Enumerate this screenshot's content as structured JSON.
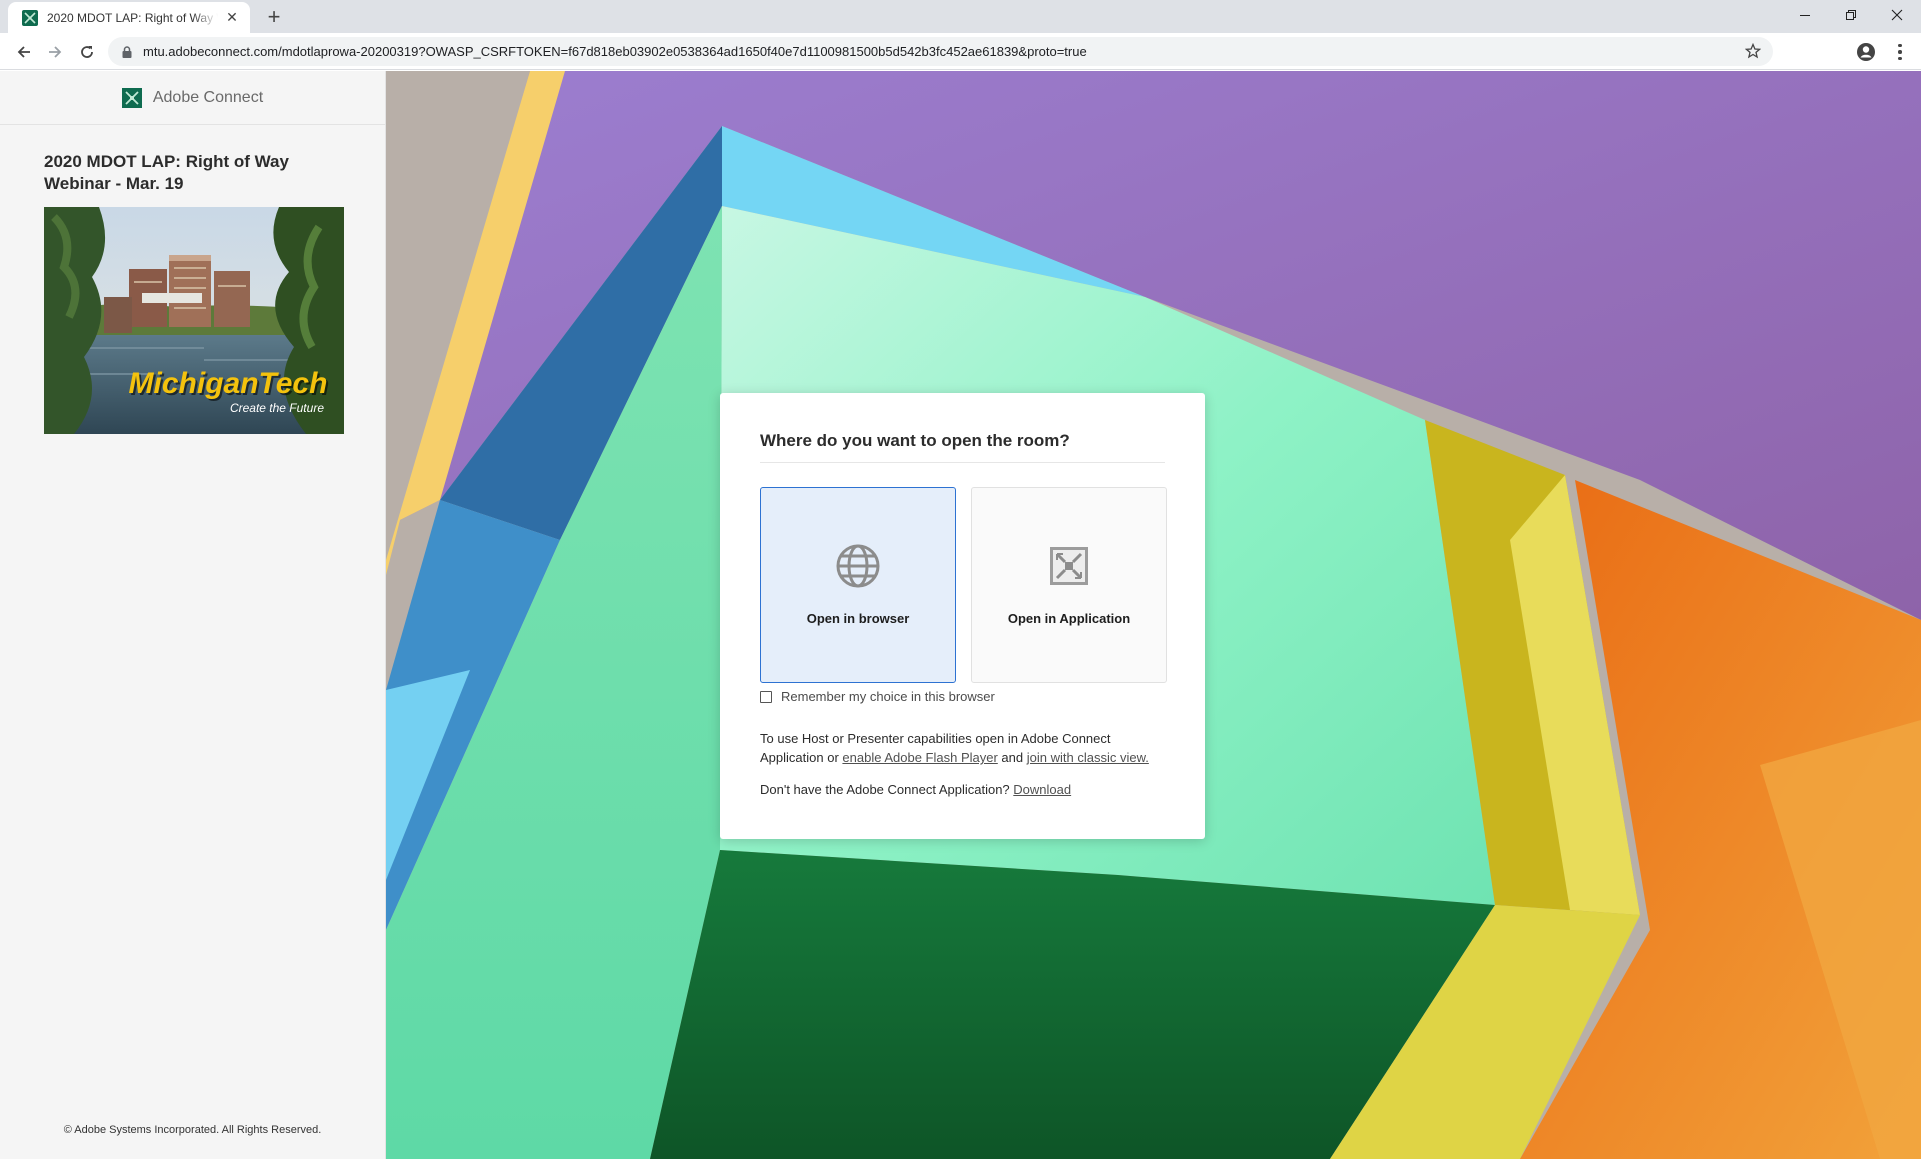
{
  "browser": {
    "tab": {
      "title": "2020 MDOT LAP: Right of Way Webinar - Mar. 19",
      "favicon": "adobe-connect-icon"
    },
    "new_tab_label": "+",
    "url": "mtu.adobeconnect.com/mdotlaprowa-20200319?OWASP_CSRFTOKEN=f67d818eb03902e0538364ad1650f40e7d1100981500b5d542b3fc452ae61839&proto=true",
    "icons": [
      "back-arrow-icon",
      "forward-arrow-icon",
      "reload-icon",
      "lock-icon",
      "star-icon",
      "profile-icon",
      "menu-dots-icon",
      "minimize-icon",
      "restore-icon",
      "close-icon"
    ]
  },
  "sidebar": {
    "brand": "Adobe Connect",
    "meeting_title": "2020 MDOT LAP: Right of Way Webinar - Mar. 19",
    "image": {
      "logo_text": "MichiganTech",
      "tagline": "Create the Future"
    },
    "copyright": "© Adobe Systems Incorporated. All Rights Reserved."
  },
  "dialog": {
    "title": "Where do you want to open the room?",
    "options": [
      {
        "label": "Open in browser",
        "icon": "globe-icon",
        "selected": true
      },
      {
        "label": "Open in Application",
        "icon": "adobe-connect-app-icon",
        "selected": false
      }
    ],
    "remember_label": "Remember my choice in this browser",
    "remember_checked": false,
    "info": {
      "prefix": "To use Host or Presenter capabilities open in Adobe Connect Application or",
      "link_flash": "enable Adobe Flash Player",
      "and": "and",
      "link_classic": "join with classic view."
    },
    "download": {
      "prefix": "Don't have the Adobe Connect Application?",
      "link": "Download"
    }
  },
  "colors": {
    "accent": "#2d72d2",
    "selected_option_bg": "#e5eefa",
    "sidebar_bg": "#f5f5f5",
    "brand_green": "#0e6b4f"
  }
}
